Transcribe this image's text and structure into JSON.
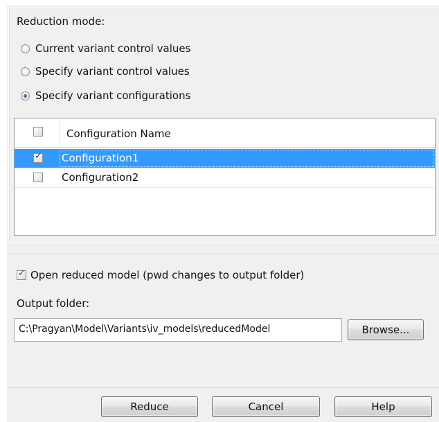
{
  "reduction": {
    "label": "Reduction mode:",
    "options": [
      {
        "label": "Current variant control values",
        "selected": false
      },
      {
        "label": "Specify variant control values",
        "selected": false
      },
      {
        "label": "Specify variant configurations",
        "selected": true
      }
    ]
  },
  "table": {
    "header": {
      "label": "Configuration Name",
      "checked": false
    },
    "rows": [
      {
        "name": "Configuration1",
        "checked": true,
        "selected": true
      },
      {
        "name": "Configuration2",
        "checked": false,
        "selected": false
      }
    ]
  },
  "open_model": {
    "label": "Open reduced model (pwd changes to output folder)",
    "checked": true
  },
  "output": {
    "label": "Output folder:",
    "value": "C:\\Pragyan\\Model\\Variants\\iv_models\\reducedModel",
    "browse": "Browse..."
  },
  "buttons": {
    "reduce": "Reduce",
    "cancel": "Cancel",
    "help": "Help"
  },
  "colors": {
    "selection": "#3399ff",
    "panel": "#f0f0f0"
  }
}
